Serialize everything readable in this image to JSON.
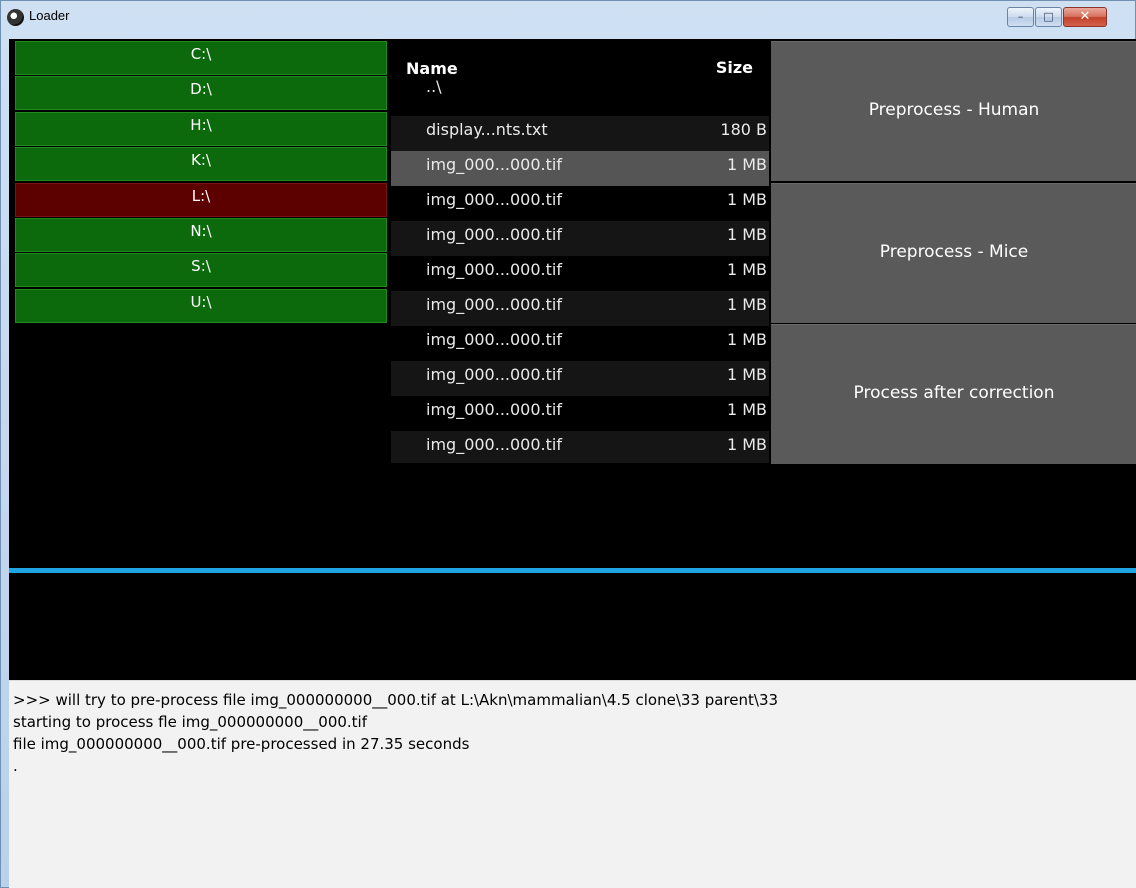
{
  "window": {
    "title": "Loader",
    "controls": {
      "minimize": "–",
      "maximize": "□",
      "close": "✕"
    }
  },
  "drives": [
    {
      "label": "C:\\",
      "state": "available"
    },
    {
      "label": "D:\\",
      "state": "available"
    },
    {
      "label": "H:\\",
      "state": "available"
    },
    {
      "label": "K:\\",
      "state": "available"
    },
    {
      "label": "L:\\",
      "state": "current"
    },
    {
      "label": "N:\\",
      "state": "available"
    },
    {
      "label": "S:\\",
      "state": "available"
    },
    {
      "label": "U:\\",
      "state": "available"
    }
  ],
  "colors": {
    "drive_available": "#0c6a0c",
    "drive_current": "#5c0000",
    "divider": "#1ea5e2",
    "action_button": "#5a5a5a"
  },
  "file_browser": {
    "headers": {
      "name": "Name",
      "size": "Size"
    },
    "parent": "..\\",
    "files": [
      {
        "name": "display...nts.txt",
        "size": "180 B"
      },
      {
        "name": "img_000...000.tif",
        "size": "1 MB",
        "selected": true
      },
      {
        "name": "img_000...000.tif",
        "size": "1 MB"
      },
      {
        "name": "img_000...000.tif",
        "size": "1 MB"
      },
      {
        "name": "img_000...000.tif",
        "size": "1 MB"
      },
      {
        "name": "img_000...000.tif",
        "size": "1 MB"
      },
      {
        "name": "img_000...000.tif",
        "size": "1 MB"
      },
      {
        "name": "img_000...000.tif",
        "size": "1 MB"
      },
      {
        "name": "img_000...000.tif",
        "size": "1 MB"
      },
      {
        "name": "img_000...000.tif",
        "size": "1 MB"
      }
    ]
  },
  "actions": {
    "preprocess_human": "Preprocess - Human",
    "preprocess_mice": "Preprocess - Mice",
    "process_after_correction": "Process after correction"
  },
  "log": {
    "lines": [
      ">>> will try to pre-process file img_000000000__000.tif at L:\\Akn\\mammalian\\4.5 clone\\33 parent\\33",
      "starting to process fle img_000000000__000.tif",
      "file img_000000000__000.tif pre-processed in 27.35 seconds",
      "."
    ]
  }
}
